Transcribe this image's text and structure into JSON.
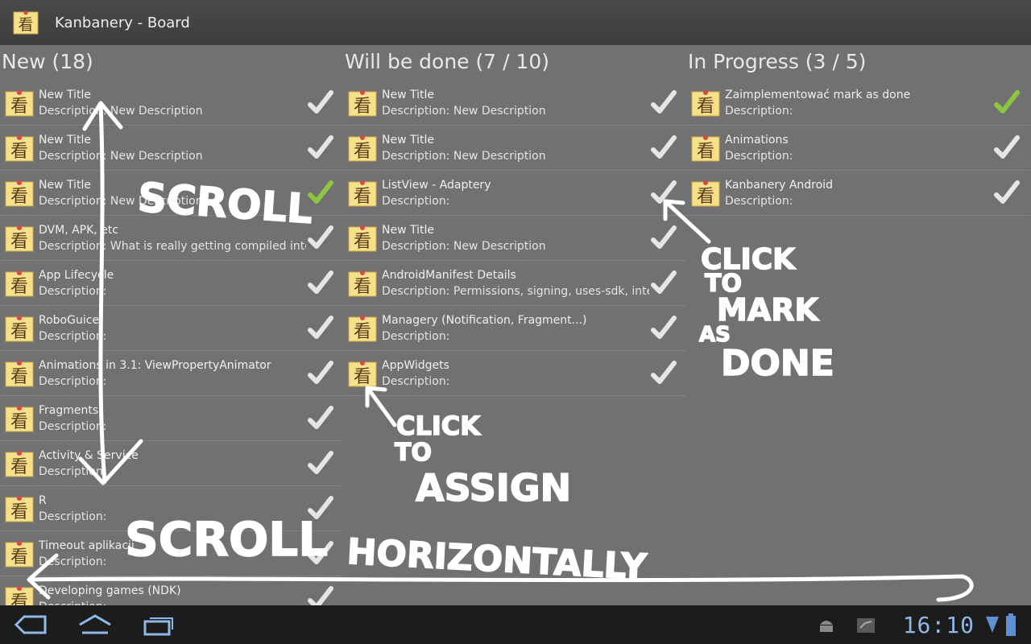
{
  "app": {
    "title": "Kanbanery - Board",
    "icon": "kanbanery-note-icon"
  },
  "columns": [
    {
      "title": "New (18)",
      "cards": [
        {
          "title": "New Title",
          "description": "Description: New Description",
          "done": false
        },
        {
          "title": "New Title",
          "description": "Description: New Description",
          "done": false
        },
        {
          "title": "New Title",
          "description": "Description: New Description",
          "done": true
        },
        {
          "title": "DVM, APK, etc",
          "description": "Description: What is really getting compiled into the",
          "done": false
        },
        {
          "title": "App Lifecycle",
          "description": "Description:",
          "done": false
        },
        {
          "title": "RoboGuice",
          "description": "Description:",
          "done": false
        },
        {
          "title": "Animations in 3.1: ViewPropertyAnimator",
          "description": "Description:",
          "done": false
        },
        {
          "title": "Fragments",
          "description": "Description:",
          "done": false
        },
        {
          "title": "Activity & Service",
          "description": "Description:",
          "done": false
        },
        {
          "title": "R",
          "description": "Description:",
          "done": false
        },
        {
          "title": "Timeout aplikacji",
          "description": "Description:",
          "done": false
        },
        {
          "title": "Developing games (NDK)",
          "description": "Description:",
          "done": false
        }
      ]
    },
    {
      "title": "Will be done (7 / 10)",
      "cards": [
        {
          "title": "New Title",
          "description": "Description: New Description",
          "done": false
        },
        {
          "title": "New Title",
          "description": "Description: New Description",
          "done": false
        },
        {
          "title": "ListView - Adaptery",
          "description": "Description:",
          "done": false
        },
        {
          "title": "New Title",
          "description": "Description: New Description",
          "done": false
        },
        {
          "title": "AndroidManifest Details",
          "description": "Description: Permissions, signing, uses-sdk, intents,",
          "done": false
        },
        {
          "title": "Managery (Notification, Fragment...)",
          "description": "Description:",
          "done": false
        },
        {
          "title": "AppWidgets",
          "description": "Description:",
          "done": false
        }
      ]
    },
    {
      "title": "In Progress (3 / 5)",
      "cards": [
        {
          "title": "Zaimplementować mark as done",
          "description": "Description:",
          "done": true
        },
        {
          "title": "Animations",
          "description": "Description:",
          "done": false
        },
        {
          "title": "Kanbanery Android",
          "description": "Description:",
          "done": false
        }
      ]
    }
  ],
  "annotations": {
    "scroll_vertical": "SCROLL",
    "scroll_horizontal_1": "SCROLL",
    "scroll_horizontal_2": "HORIZONTALLY",
    "mark_done": [
      "CLICK",
      "TO",
      "MARK",
      "AS",
      "DONE"
    ],
    "assign": [
      "CLICK",
      "TO",
      "ASSIGN"
    ]
  },
  "statusbar": {
    "time": "16:10",
    "icons": [
      "back-icon",
      "home-icon",
      "recent-apps-icon",
      "android-debug-icon",
      "notification-icon",
      "wifi-icon",
      "battery-icon"
    ]
  },
  "colors": {
    "check_done": "#8cc63f",
    "check_pending": "#e6e6e6",
    "clock": "#8fb8e6"
  }
}
